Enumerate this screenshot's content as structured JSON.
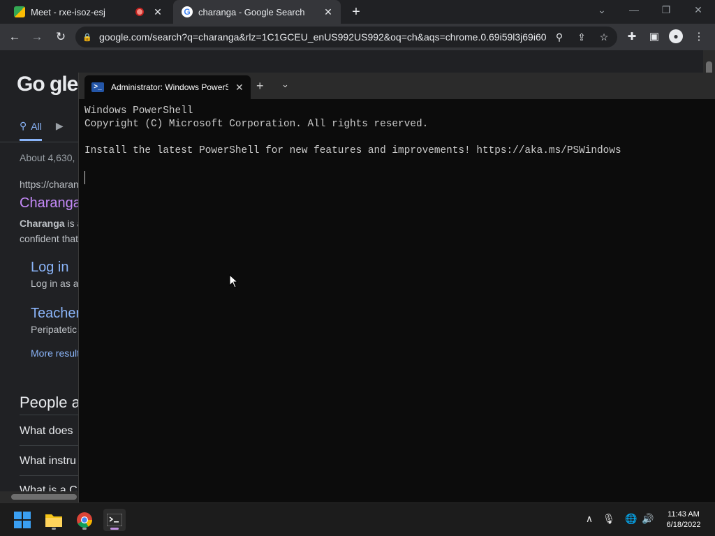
{
  "browser": {
    "tabs": [
      {
        "title": "Meet - rxe-isoz-esj",
        "active": false
      },
      {
        "title": "charanga - Google Search",
        "active": true
      }
    ],
    "url": "google.com/search?q=charanga&rlz=1C1GCEU_enUS992US992&oq=ch&aqs=chrome.0.69i59l3j69i60..."
  },
  "google": {
    "logo_partial": "Go gle",
    "tab_all": "All",
    "stats": "About 4,630,",
    "result": {
      "cite": "https://charan",
      "title": "Charanga",
      "snippet_bold": "Charanga",
      "snippet_rest": " is a",
      "snippet_line2": "confident that"
    },
    "sublinks": [
      {
        "title": "Log in",
        "snippet": "Log in as a"
      },
      {
        "title": "Teacher",
        "snippet": "Peripatetic"
      }
    ],
    "more_results": "More result",
    "people_also_ask": "People a",
    "questions": [
      "What does",
      "What instru",
      "What is a C"
    ]
  },
  "terminal": {
    "tab_title": "Administrator: Windows PowerS",
    "lines": [
      "Windows PowerShell",
      "Copyright (C) Microsoft Corporation. All rights reserved.",
      "",
      "Install the latest PowerShell for new features and improvements! https://aka.ms/PSWindows"
    ]
  },
  "taskbar": {
    "time": "11:43 AM",
    "date": "6/18/2022"
  },
  "colors": {
    "terminal_bg": "#0c0c0c",
    "chrome_dark": "#202124",
    "link_blue": "#8ab4f8",
    "visited_purple": "#c58af9"
  }
}
